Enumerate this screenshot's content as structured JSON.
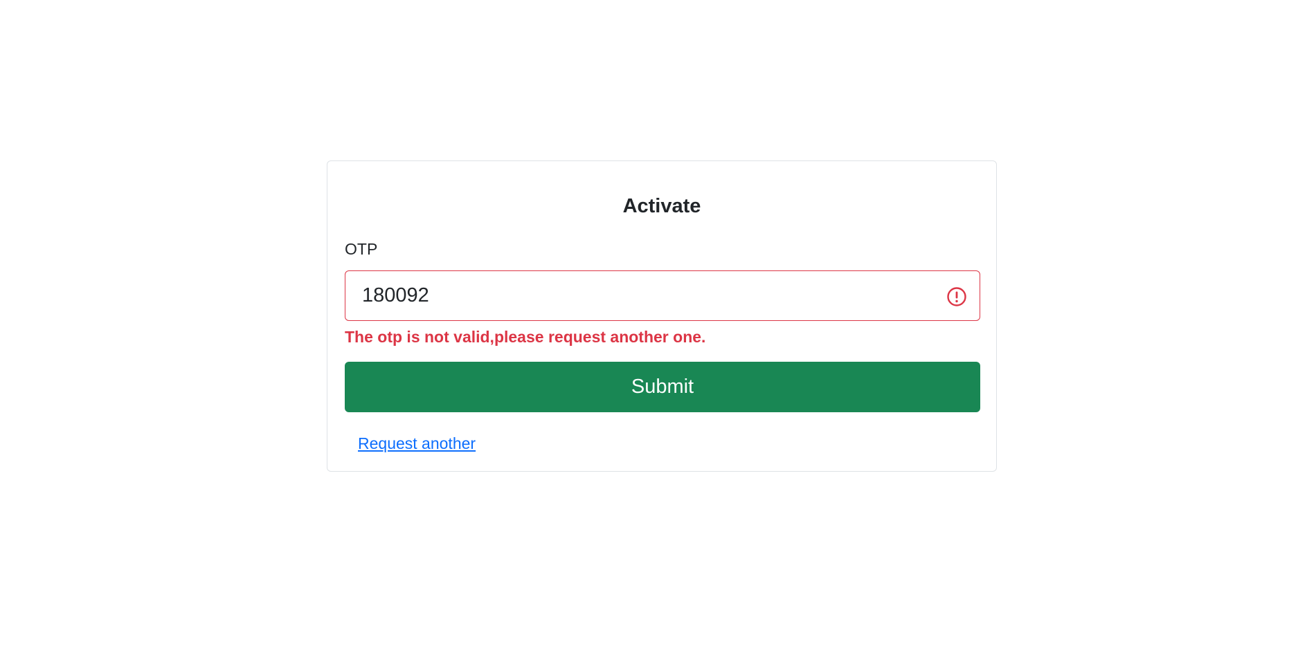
{
  "form": {
    "title": "Activate",
    "otp_label": "OTP",
    "otp_value": "180092",
    "error_message": "The otp is not valid,please request another one.",
    "submit_label": "Submit",
    "request_link_label": "Request another"
  },
  "icons": {
    "input_status": "exclamation-circle-icon"
  },
  "colors": {
    "error": "#dc3545",
    "success_button": "#198754",
    "link": "#0d6efd",
    "card_border": "#dee2e6"
  }
}
